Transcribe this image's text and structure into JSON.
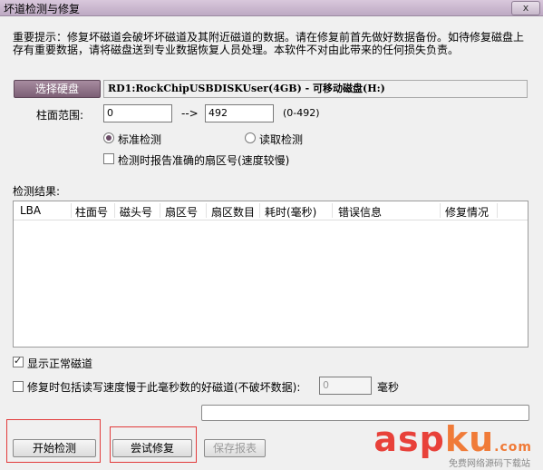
{
  "window": {
    "title": "坏道检测与修复",
    "close_label": "x"
  },
  "notice": "重要提示：修复坏磁道会破坏坏磁道及其附近磁道的数据。请在修复前首先做好数据备份。如待修复磁盘上存有重要数据，请将磁盘送到专业数据恢复人员处理。本软件不对由此带来的任何损失负责。",
  "disk": {
    "select_label": "选择硬盘",
    "info": "RD1:RockChipUSBDISKUser(4GB) - 可移动磁盘(H:)"
  },
  "cylinder": {
    "label": "柱面范围:",
    "from": "0",
    "arrow": "-->",
    "to": "492",
    "range_hint": "(0-492)"
  },
  "mode": {
    "standard": "标准检测",
    "read": "读取检测",
    "selected": "standard"
  },
  "report_sector": {
    "label": "检测时报告准确的扇区号(速度较慢)",
    "checked": false
  },
  "results": {
    "label": "检测结果:",
    "columns": [
      "LBA",
      "柱面号",
      "磁头号",
      "扇区号",
      "扇区数目",
      "耗时(毫秒)",
      "错误信息",
      "修复情况"
    ],
    "rows": []
  },
  "show_normal": {
    "label": "显示正常磁道",
    "checked": true
  },
  "repair_slow": {
    "label": "修复时包括读写速度慢于此毫秒数的好磁道(不破坏数据):",
    "value": "0",
    "unit": "毫秒",
    "checked": false
  },
  "status_text": "",
  "buttons": {
    "start": "开始检测",
    "repair": "尝试修复",
    "save_report": "保存报表"
  },
  "watermark": {
    "brand_a": "asp",
    "brand_b": "ku",
    "suffix": ".com",
    "sub": "免费网络源码下载站"
  },
  "colors": {
    "title_bar": "#c7b5cb",
    "select_button": "#8d6f86",
    "highlight_box": "#e23b3b",
    "watermark": "#e8413a"
  }
}
